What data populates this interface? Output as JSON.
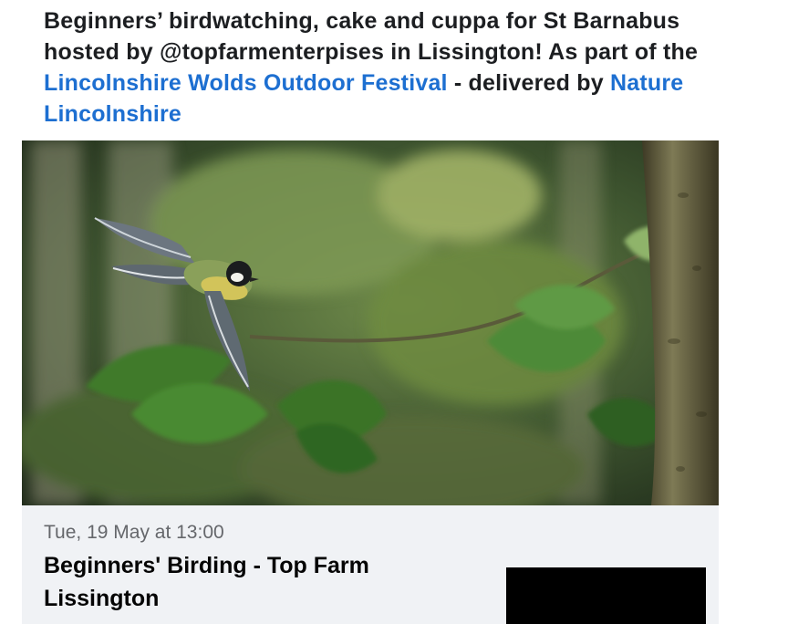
{
  "post": {
    "text_part1": "Beginners’ birdwatching, cake and cuppa for St Barnabus hosted by @topfarmenterpises in Lissington! As part of the ",
    "link1": "Lincolnshire Wolds Outdoor Festival",
    "text_part2": " - delivered by ",
    "link2": "Nature Lincolnshire",
    "link_color": "#1d6fd1"
  },
  "media": {
    "subject": "great-tit bird in flight among forest leaves"
  },
  "event": {
    "date": "Tue, 19 May at 13:00",
    "title": "Beginners' Birding - Top Farm Lissington"
  }
}
